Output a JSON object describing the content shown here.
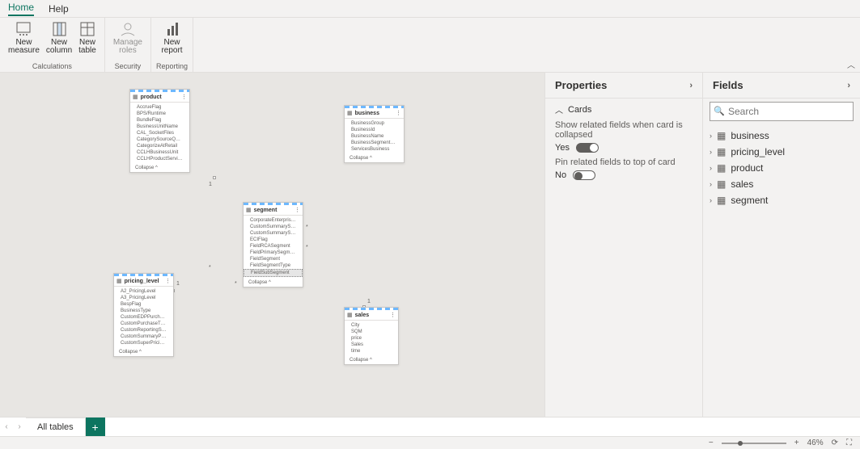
{
  "menu": {
    "home": "Home",
    "help": "Help"
  },
  "ribbon": {
    "new_measure": "New\nmeasure",
    "new_column": "New\ncolumn",
    "new_table": "New\ntable",
    "manage_roles": "Manage\nroles",
    "new_report": "New\nreport",
    "group_calc": "Calculations",
    "group_sec": "Security",
    "group_rep": "Reporting"
  },
  "canvas": {
    "cards": {
      "product": {
        "title": "product",
        "rows": [
          "AccrueFlag",
          "BPS/Runtime",
          "BundleFlag",
          "BusinessUnitName",
          "CAL_SocketFiles",
          "CategorySourceQRMPath",
          "CategorizeAtRetail",
          "CCLHBusinessUnit",
          "CCLHProductServicesAndSensors"
        ],
        "collapse": "Collapse ^"
      },
      "business": {
        "title": "business",
        "rows": [
          "BusinessGroup",
          "BusinessId",
          "BusinessName",
          "BusinessSegmentName",
          "ServicesBusiness"
        ],
        "collapse": "Collapse ^"
      },
      "segment": {
        "title": "segment",
        "rows": [
          "CorporateEnterpriseFlag",
          "CustomSummarySector",
          "CustomSummarySegment",
          "ECIFlag",
          "FieldRCASegment",
          "FieldPrimarySegment",
          "FieldSegment",
          "FieldSegmentType",
          "FieldSubSegment"
        ],
        "collapse": "Collapse ^"
      },
      "pricing_level": {
        "title": "pricing_level",
        "rows": [
          "A2_PricingLevel",
          "A3_PricingLevel",
          "BespFlag",
          "BusinessType",
          "CustomEDPPurchaseType",
          "CustomPurchaseType",
          "CustomReportingSummaryAcc…",
          "CustomSummaryPurchaseType",
          "CustomSuperPricingLevel"
        ],
        "collapse": "Collapse ^"
      },
      "sales": {
        "title": "sales",
        "rows": [
          "City",
          "SQM",
          "price",
          "Sales",
          "time"
        ],
        "collapse": "Collapse ^"
      }
    }
  },
  "properties": {
    "header": "Properties",
    "section_cards": "Cards",
    "related_label": "Show related fields when card is collapsed",
    "related_value": "Yes",
    "pin_label": "Pin related fields to top of card",
    "pin_value": "No"
  },
  "fields": {
    "header": "Fields",
    "search_placeholder": "Search",
    "items": [
      "business",
      "pricing_level",
      "product",
      "sales",
      "segment"
    ]
  },
  "tabs": {
    "all": "All tables"
  },
  "status": {
    "zoom": "46%"
  }
}
